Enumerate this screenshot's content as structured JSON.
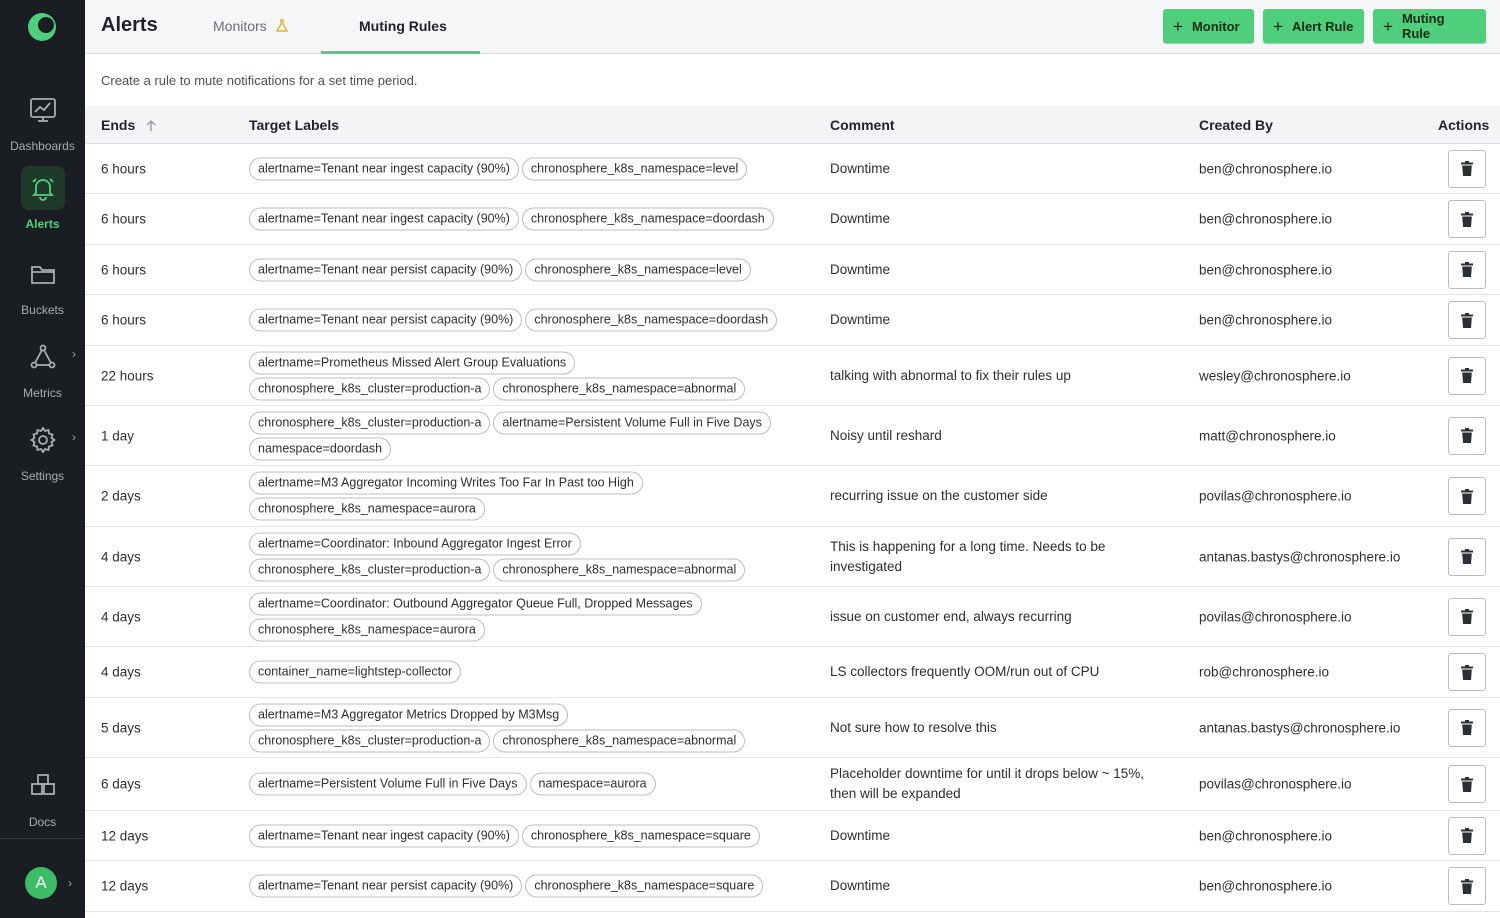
{
  "app": {
    "title": "Alerts",
    "description": "Create a rule to mute notifications for a set time period."
  },
  "sidebar": {
    "items": [
      {
        "label": "Dashboards",
        "icon": "dashboard-icon"
      },
      {
        "label": "Alerts",
        "icon": "bell-icon"
      },
      {
        "label": "Buckets",
        "icon": "folder-icon"
      },
      {
        "label": "Metrics",
        "icon": "graph-icon"
      },
      {
        "label": "Settings",
        "icon": "gear-icon"
      },
      {
        "label": "Docs",
        "icon": "docs-icon"
      }
    ],
    "avatar": "A"
  },
  "tabs": [
    {
      "label": "Monitors"
    },
    {
      "label": "Muting Rules"
    }
  ],
  "buttons": {
    "monitor": "Monitor",
    "alert_rule": "Alert Rule",
    "muting_rule": "Muting Rule"
  },
  "table": {
    "headers": {
      "ends": "Ends",
      "target_labels": "Target Labels",
      "comment": "Comment",
      "created_by": "Created By",
      "actions": "Actions"
    },
    "rows": [
      {
        "ends": "6 hours",
        "labels": [
          "alertname=Tenant near ingest capacity (90%)",
          "chronosphere_k8s_namespace=level"
        ],
        "comment": "Downtime",
        "created_by": "ben@chronosphere.io"
      },
      {
        "ends": "6 hours",
        "labels": [
          "alertname=Tenant near ingest capacity (90%)",
          "chronosphere_k8s_namespace=doordash"
        ],
        "comment": "Downtime",
        "created_by": "ben@chronosphere.io"
      },
      {
        "ends": "6 hours",
        "labels": [
          "alertname=Tenant near persist capacity (90%)",
          "chronosphere_k8s_namespace=level"
        ],
        "comment": "Downtime",
        "created_by": "ben@chronosphere.io"
      },
      {
        "ends": "6 hours",
        "labels": [
          "alertname=Tenant near persist capacity (90%)",
          "chronosphere_k8s_namespace=doordash"
        ],
        "comment": "Downtime",
        "created_by": "ben@chronosphere.io"
      },
      {
        "ends": "22 hours",
        "labels": [
          "alertname=Prometheus Missed Alert Group Evaluations",
          "chronosphere_k8s_cluster=production-a",
          "chronosphere_k8s_namespace=abnormal"
        ],
        "comment": "talking with abnormal to fix their rules up",
        "created_by": "wesley@chronosphere.io"
      },
      {
        "ends": "1 day",
        "labels": [
          "chronosphere_k8s_cluster=production-a",
          "alertname=Persistent Volume Full in Five Days",
          "namespace=doordash"
        ],
        "comment": "Noisy until reshard",
        "created_by": "matt@chronosphere.io"
      },
      {
        "ends": "2 days",
        "labels": [
          "alertname=M3 Aggregator Incoming Writes Too Far In Past too High",
          "chronosphere_k8s_namespace=aurora"
        ],
        "comment": "recurring issue on the customer side",
        "created_by": "povilas@chronosphere.io"
      },
      {
        "ends": "4 days",
        "labels": [
          "alertname=Coordinator: Inbound Aggregator Ingest Error",
          "chronosphere_k8s_cluster=production-a",
          "chronosphere_k8s_namespace=abnormal"
        ],
        "comment": "This is happening for a long time. Needs to be investigated",
        "created_by": "antanas.bastys@chronosphere.io"
      },
      {
        "ends": "4 days",
        "labels": [
          "alertname=Coordinator: Outbound Aggregator Queue Full, Dropped Messages",
          "chronosphere_k8s_namespace=aurora"
        ],
        "comment": "issue on customer end, always recurring",
        "created_by": "povilas@chronosphere.io"
      },
      {
        "ends": "4 days",
        "labels": [
          "container_name=lightstep-collector"
        ],
        "comment": "LS collectors frequently OOM/run out of CPU",
        "created_by": "rob@chronosphere.io"
      },
      {
        "ends": "5 days",
        "labels": [
          "alertname=M3 Aggregator Metrics Dropped by M3Msg",
          "chronosphere_k8s_cluster=production-a",
          "chronosphere_k8s_namespace=abnormal"
        ],
        "comment": "Not sure how to resolve this",
        "created_by": "antanas.bastys@chronosphere.io"
      },
      {
        "ends": "6 days",
        "labels": [
          "alertname=Persistent Volume Full in Five Days",
          "namespace=aurora"
        ],
        "comment": "Placeholder downtime for until it drops below ~ 15%, then will be expanded",
        "created_by": "povilas@chronosphere.io"
      },
      {
        "ends": "12 days",
        "labels": [
          "alertname=Tenant near ingest capacity (90%)",
          "chronosphere_k8s_namespace=square"
        ],
        "comment": "Downtime",
        "created_by": "ben@chronosphere.io"
      },
      {
        "ends": "12 days",
        "labels": [
          "alertname=Tenant near persist capacity (90%)",
          "chronosphere_k8s_namespace=square"
        ],
        "comment": "Downtime",
        "created_by": "ben@chronosphere.io"
      }
    ]
  },
  "colors": {
    "accent": "#4fce7c",
    "sidebar_bg": "#1a1d21",
    "warning": "#e8b23a"
  }
}
